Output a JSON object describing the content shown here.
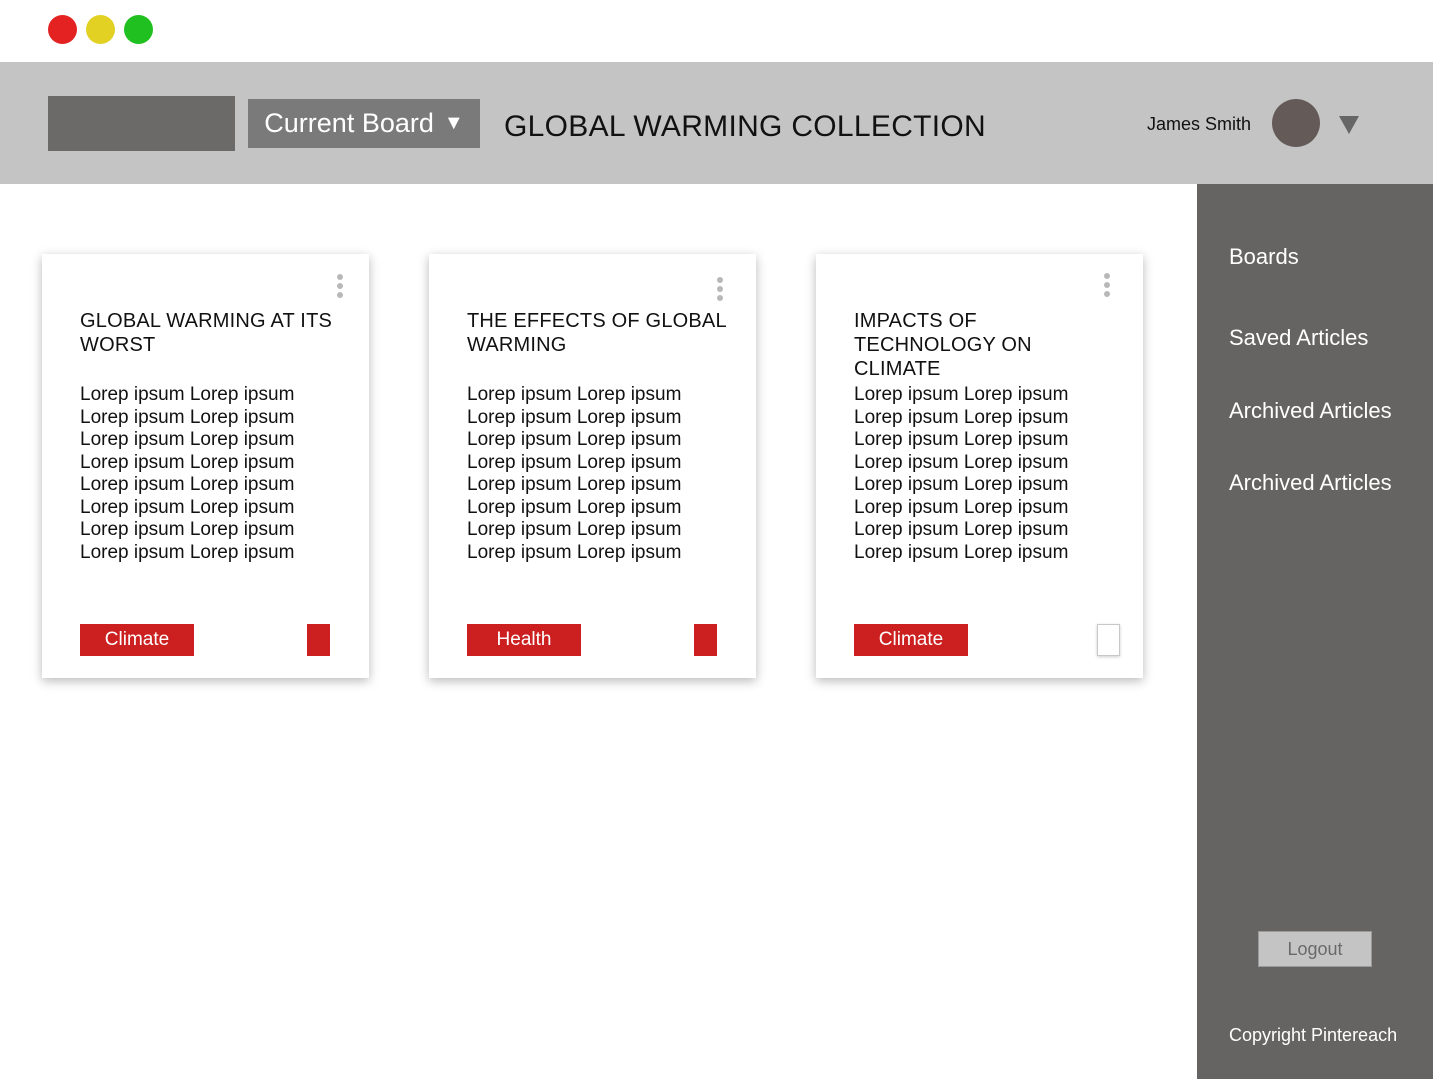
{
  "window": {
    "controls": [
      "close",
      "minimize",
      "maximize"
    ]
  },
  "header": {
    "board_select_label": "Current Board",
    "page_title": "GLOBAL WARMING COLLECTION",
    "user_name": "James Smith"
  },
  "cards": [
    {
      "title": "GLOBAL WARMING AT ITS WORST",
      "body_lines": [
        "Lorep ipsum Lorep ipsum",
        "Lorep ipsum Lorep ipsum",
        "Lorep ipsum Lorep ipsum",
        "Lorep ipsum Lorep ipsum",
        "Lorep ipsum Lorep ipsum",
        "Lorep ipsum Lorep ipsum",
        "Lorep ipsum Lorep ipsum",
        "Lorep ipsum Lorep ipsum"
      ],
      "tag": "Climate",
      "saved": true
    },
    {
      "title": "THE EFFECTS OF GLOBAL WARMING",
      "body_lines": [
        "Lorep ipsum Lorep ipsum",
        "Lorep ipsum Lorep ipsum",
        "Lorep ipsum Lorep ipsum",
        "Lorep ipsum Lorep ipsum",
        "Lorep ipsum Lorep ipsum",
        "Lorep ipsum Lorep ipsum",
        "Lorep ipsum Lorep ipsum",
        "Lorep ipsum Lorep ipsum"
      ],
      "tag": "Health",
      "saved": true
    },
    {
      "title": "IMPACTS OF TECHNOLOGY ON CLIMATE",
      "body_lines": [
        "Lorep ipsum Lorep ipsum",
        "Lorep ipsum Lorep ipsum",
        "Lorep ipsum Lorep ipsum",
        "Lorep ipsum Lorep ipsum",
        "Lorep ipsum Lorep ipsum",
        "Lorep ipsum Lorep ipsum",
        "Lorep ipsum Lorep ipsum",
        "Lorep ipsum Lorep ipsum"
      ],
      "tag": "Climate",
      "saved": false
    }
  ],
  "sidebar": {
    "items": [
      {
        "label": "Boards"
      },
      {
        "label": "Saved Articles"
      },
      {
        "label": "Archived Articles"
      },
      {
        "label": "Archived Articles"
      }
    ],
    "logout_label": "Logout",
    "copyright": "Copyright Pintereach"
  },
  "colors": {
    "header_bg": "#c4c4c4",
    "sidebar_bg": "#656462",
    "tag_red": "#cc1f1f",
    "close_dot": "#e42222",
    "minimize_dot": "#e2d122",
    "maximize_dot": "#20c020"
  },
  "icons": {
    "board_select": "caret-down-icon",
    "user_menu": "caret-down-icon",
    "card_menu": "kebab-menu-icon"
  }
}
